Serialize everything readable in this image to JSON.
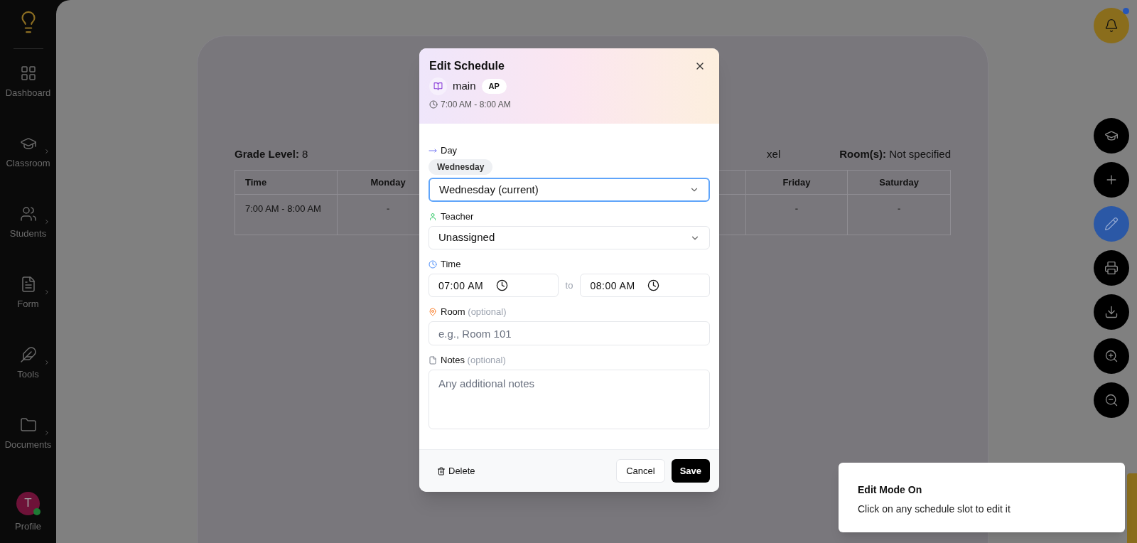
{
  "sidebar": {
    "items": [
      {
        "label": "Dashboard",
        "expandable": false
      },
      {
        "label": "Classroom",
        "expandable": true
      },
      {
        "label": "Students",
        "expandable": true
      },
      {
        "label": "Form",
        "expandable": true
      },
      {
        "label": "Tools",
        "expandable": true
      },
      {
        "label": "Documents",
        "expandable": true
      }
    ],
    "profile": {
      "initial": "T",
      "label": "Profile",
      "online": true
    }
  },
  "schedule": {
    "info": [
      {
        "label": "Grade Level:",
        "value": "8"
      },
      {
        "value": "xel"
      },
      {
        "label": "Room(s):",
        "value": "Not specified"
      }
    ],
    "columns": [
      "Time",
      "Monday",
      "Friday",
      "Saturday"
    ],
    "rows": [
      {
        "cells": [
          "7:00 AM - 8:00 AM",
          "-",
          "-",
          "-"
        ]
      }
    ]
  },
  "notifications": {
    "unread": true
  },
  "actions": [
    {
      "selected": false
    },
    {
      "selected": false
    },
    {
      "selected": true
    },
    {
      "selected": false
    },
    {
      "selected": false
    },
    {
      "selected": false
    },
    {
      "selected": false
    }
  ],
  "modal": {
    "title": "Edit Schedule",
    "subject": "main",
    "badge": "AP",
    "time": "7:00 AM - 8:00 AM",
    "day": {
      "label": "Day",
      "chip": "Wednesday",
      "value": "Wednesday (current)",
      "focused": true
    },
    "teacher": {
      "label": "Teacher",
      "value": "Unassigned"
    },
    "time_field": {
      "label": "Time",
      "start": "07:00 AM",
      "separator": "to",
      "end": "08:00 AM"
    },
    "room": {
      "label": "Room",
      "hint": "(optional)",
      "placeholder": "e.g., Room 101"
    },
    "notes": {
      "label": "Notes",
      "hint": "(optional)",
      "placeholder": "Any additional notes"
    },
    "buttons": {
      "delete": "Delete",
      "cancel": "Cancel",
      "save": "Save"
    }
  },
  "toast": {
    "title": "Edit Mode On",
    "message": "Click on any schedule slot to edit it"
  }
}
